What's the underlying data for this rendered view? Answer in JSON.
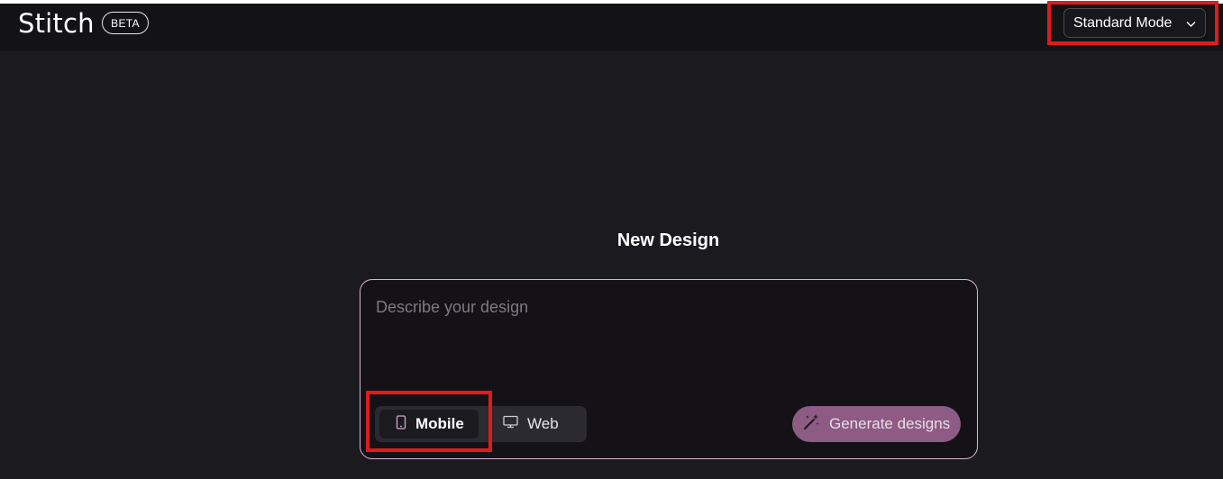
{
  "header": {
    "logo": "Stitch",
    "badge": "BETA",
    "mode_select": {
      "value": "Standard Mode",
      "icon": "chevron-down-icon"
    }
  },
  "main": {
    "title": "New Design",
    "prompt": {
      "placeholder": "Describe your design",
      "value": ""
    },
    "device_toggle": {
      "options": [
        {
          "label": "Mobile",
          "icon": "phone-icon",
          "selected": true
        },
        {
          "label": "Web",
          "icon": "monitor-icon",
          "selected": false
        }
      ]
    },
    "generate_button": {
      "label": "Generate designs",
      "icon": "magic-wand-icon"
    }
  },
  "colors": {
    "background": "#1b1b1f",
    "header": "#131215",
    "card_border": "#d7b5d4",
    "accent": "#8e5b85",
    "annotation": "#e01b1b"
  }
}
